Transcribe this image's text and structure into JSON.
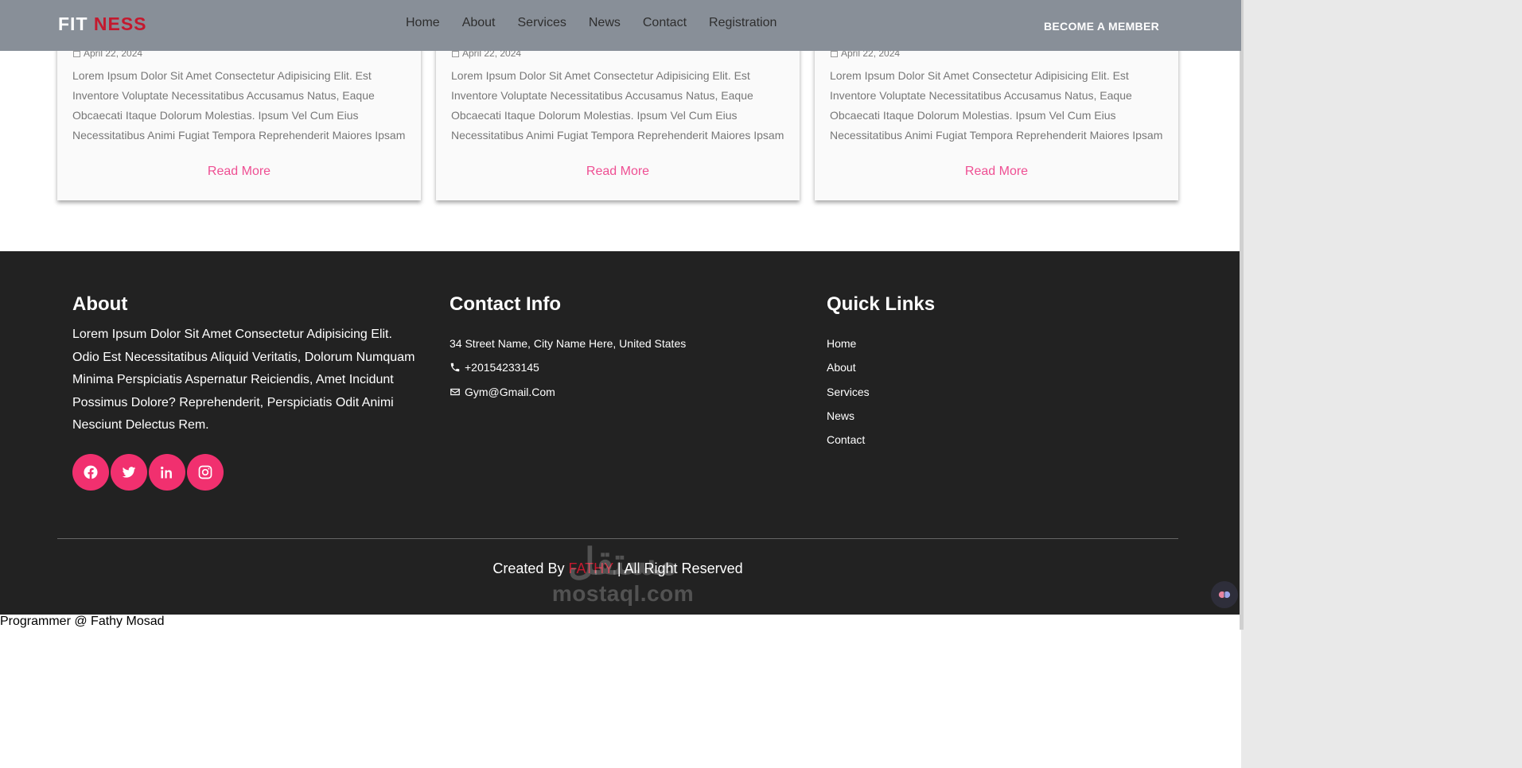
{
  "header": {
    "logo_left": "FIT",
    "logo_right": "NESS",
    "nav": [
      "Home",
      "About",
      "Services",
      "News",
      "Contact",
      "Registration"
    ],
    "cta": "BECOME A MEMBER"
  },
  "news": {
    "cards": [
      {
        "date": "April 22, 2024",
        "text": "Lorem Ipsum Dolor Sit Amet Consectetur Adipisicing Elit. Est Inventore Voluptate Necessitatibus Accusamus Natus, Eaque Obcaecati Itaque Dolorum Molestias. Ipsum Vel Cum Eius Necessitatibus Animi Fugiat Tempora Reprehenderit Maiores Ipsam",
        "link": "Read More"
      },
      {
        "date": "April 22, 2024",
        "text": "Lorem Ipsum Dolor Sit Amet Consectetur Adipisicing Elit. Est Inventore Voluptate Necessitatibus Accusamus Natus, Eaque Obcaecati Itaque Dolorum Molestias. Ipsum Vel Cum Eius Necessitatibus Animi Fugiat Tempora Reprehenderit Maiores Ipsam",
        "link": "Read More"
      },
      {
        "date": "April 22, 2024",
        "text": "Lorem Ipsum Dolor Sit Amet Consectetur Adipisicing Elit. Est Inventore Voluptate Necessitatibus Accusamus Natus, Eaque Obcaecati Itaque Dolorum Molestias. Ipsum Vel Cum Eius Necessitatibus Animi Fugiat Tempora Reprehenderit Maiores Ipsam",
        "link": "Read More"
      }
    ]
  },
  "footer": {
    "about": {
      "title": "About",
      "text": "Lorem Ipsum Dolor Sit Amet Consectetur Adipisicing Elit. Odio Est Necessitatibus Aliquid Veritatis, Dolorum Numquam Minima Perspiciatis Aspernatur Reiciendis, Amet Incidunt Possimus Dolore? Reprehenderit, Perspiciatis Odit Animi Nesciunt Delectus Rem.",
      "socials": [
        "facebook-icon",
        "twitter-icon",
        "linkedin-icon",
        "instagram-icon"
      ]
    },
    "contact": {
      "title": "Contact Info",
      "address": "34 Street Name, City Name Here, United States",
      "phone": "+20154233145",
      "email": "Gym@Gmail.Com"
    },
    "links": {
      "title": "Quick Links",
      "items": [
        "Home",
        "About",
        "Services",
        "News",
        "Contact"
      ]
    },
    "copyright": {
      "prefix": "Created By",
      "author": "FATHY",
      "suffix": "| All Right Reserved"
    }
  },
  "watermark": {
    "arabic": "مستقل",
    "latin": "mostaql.com"
  },
  "bottom_caption": "Programmer @ Fathy Mosad",
  "colors": {
    "header_bg": "#888f98",
    "brand_red": "#c4192e",
    "accent_pink": "#ef4f93",
    "social_pink": "#f1306f",
    "footer_bg": "#222222"
  }
}
